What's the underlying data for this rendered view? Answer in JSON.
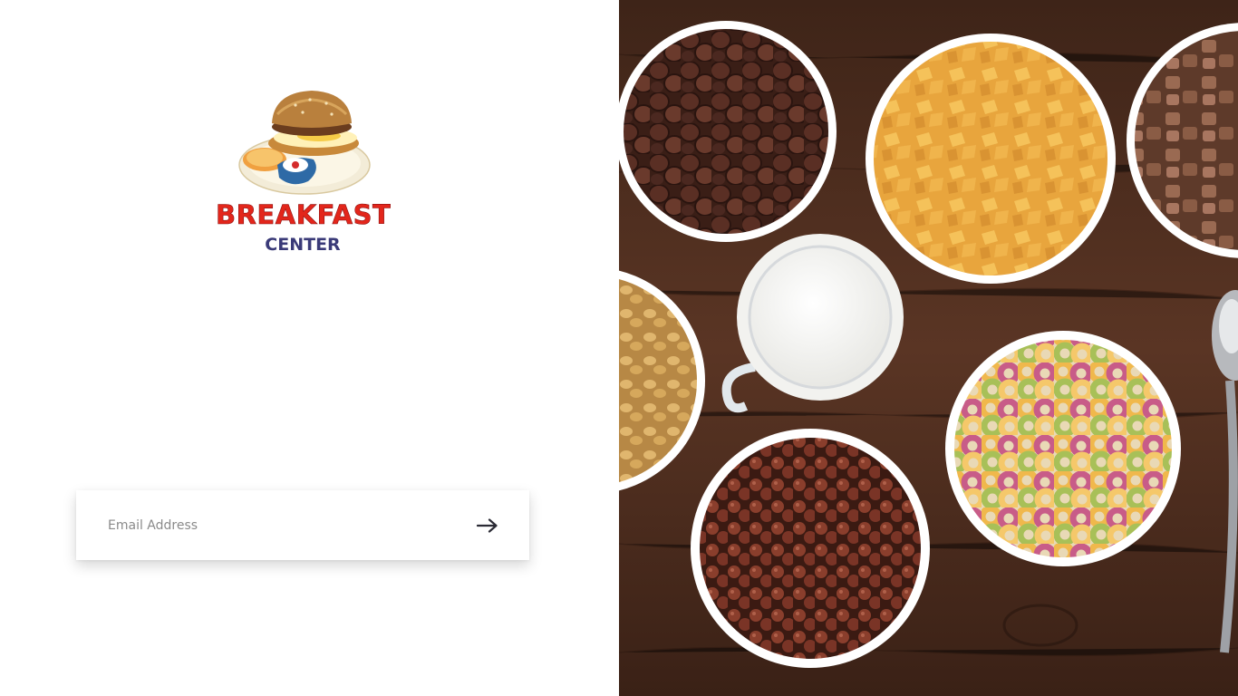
{
  "brand": {
    "name": "BREAKFAST",
    "subtitle": "CENTER",
    "name_color": "#e3261b",
    "subtitle_color": "#3a3a78"
  },
  "login": {
    "email_placeholder": "Email Address",
    "email_value": "",
    "submit_icon": "arrow-right-icon"
  },
  "hero": {
    "description_icon": "cereal-bowls-photo",
    "wood_color": "#4a2c1e"
  }
}
